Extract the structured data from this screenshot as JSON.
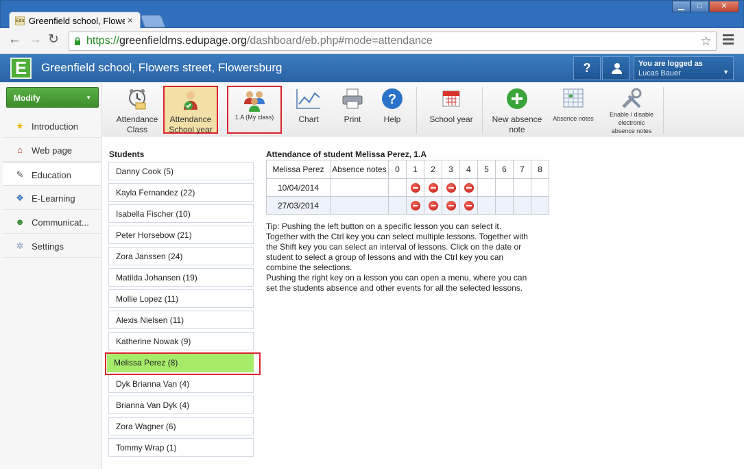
{
  "browser": {
    "tab_title": "Greenfield school, Flowers",
    "tab_close": "×",
    "favicon_text": "Edu",
    "url_secure": "https://",
    "url_host": "greenfieldms.edupage.org",
    "url_path": "/dashboard/eb.php#mode=attendance",
    "win_min": "▁",
    "win_max": "□",
    "win_close": "✕"
  },
  "header": {
    "logo_letter": "E",
    "school_name": "Greenfield school, Flowers street, Flowersburg",
    "help_label": "?",
    "login_label": "You are logged as",
    "login_user": "Lucas Bauer"
  },
  "sidebar": {
    "modify_label": "Modify",
    "items": [
      {
        "label": "Introduction",
        "icon": "star-icon"
      },
      {
        "label": "Web page",
        "icon": "house-icon"
      },
      {
        "label": "Education",
        "icon": "graduation-icon"
      },
      {
        "label": "E-Learning",
        "icon": "elearning-icon"
      },
      {
        "label": "Communicat...",
        "icon": "people-icon"
      },
      {
        "label": "Settings",
        "icon": "gear-icon"
      }
    ]
  },
  "ribbon": {
    "attendance_class_1": "Attendance",
    "attendance_class_2": "Class",
    "attendance_school_1": "Attendance",
    "attendance_school_2": "School year",
    "my_class": "1.A (My class)",
    "chart": "Chart",
    "print": "Print",
    "help": "Help",
    "school_year": "School year",
    "new_absence_1": "New absence",
    "new_absence_2": "note",
    "absence_notes": "Absence notes",
    "enable_1": "Enable / disable",
    "enable_2": "electronic",
    "enable_3": "absence notes"
  },
  "students": {
    "title": "Students",
    "list": [
      "Danny Cook (5)",
      "Kayla Fernandez (22)",
      "Isabella Fischer (10)",
      "Peter Horsebow (21)",
      "Zora Janssen (24)",
      "Matilda Johansen (19)",
      "Mollie Lopez (11)",
      "Alexis Nielsen (11)",
      "Katherine Nowak (9)",
      "Melissa Perez (8)",
      "Dyk Brianna Van (4)",
      "Brianna Van Dyk (4)",
      "Zora Wagner (6)",
      "Tommy Wrap (1)"
    ],
    "selected_index": 9
  },
  "attendance": {
    "title": "Attendance of student Melissa Perez, 1.A",
    "student_header": "Melissa Perez",
    "notes_header": "Absence notes",
    "lessons": [
      "0",
      "1",
      "2",
      "3",
      "4",
      "5",
      "6",
      "7",
      "8"
    ],
    "rows": [
      {
        "date": "10/04/2014",
        "absent_lessons": [
          1,
          2,
          3,
          4
        ]
      },
      {
        "date": "27/03/2014",
        "absent_lessons": [
          1,
          2,
          3,
          4
        ]
      }
    ],
    "absent_color": "#d4241a"
  },
  "tip": {
    "lines": [
      "Tip: Pushing the left button on a specific lesson you can select it.",
      "Together with the Ctrl key you can select multiple lessons. Together with",
      "the Shift key you can select an interval of lessons. Click on the date or",
      "student to select a group of lessons and with the Ctrl key you can",
      "combine the selections.",
      "Pushing the right key on a lesson you can open a menu, where you can",
      "set the students absence and other events for all the selected lessons."
    ]
  }
}
